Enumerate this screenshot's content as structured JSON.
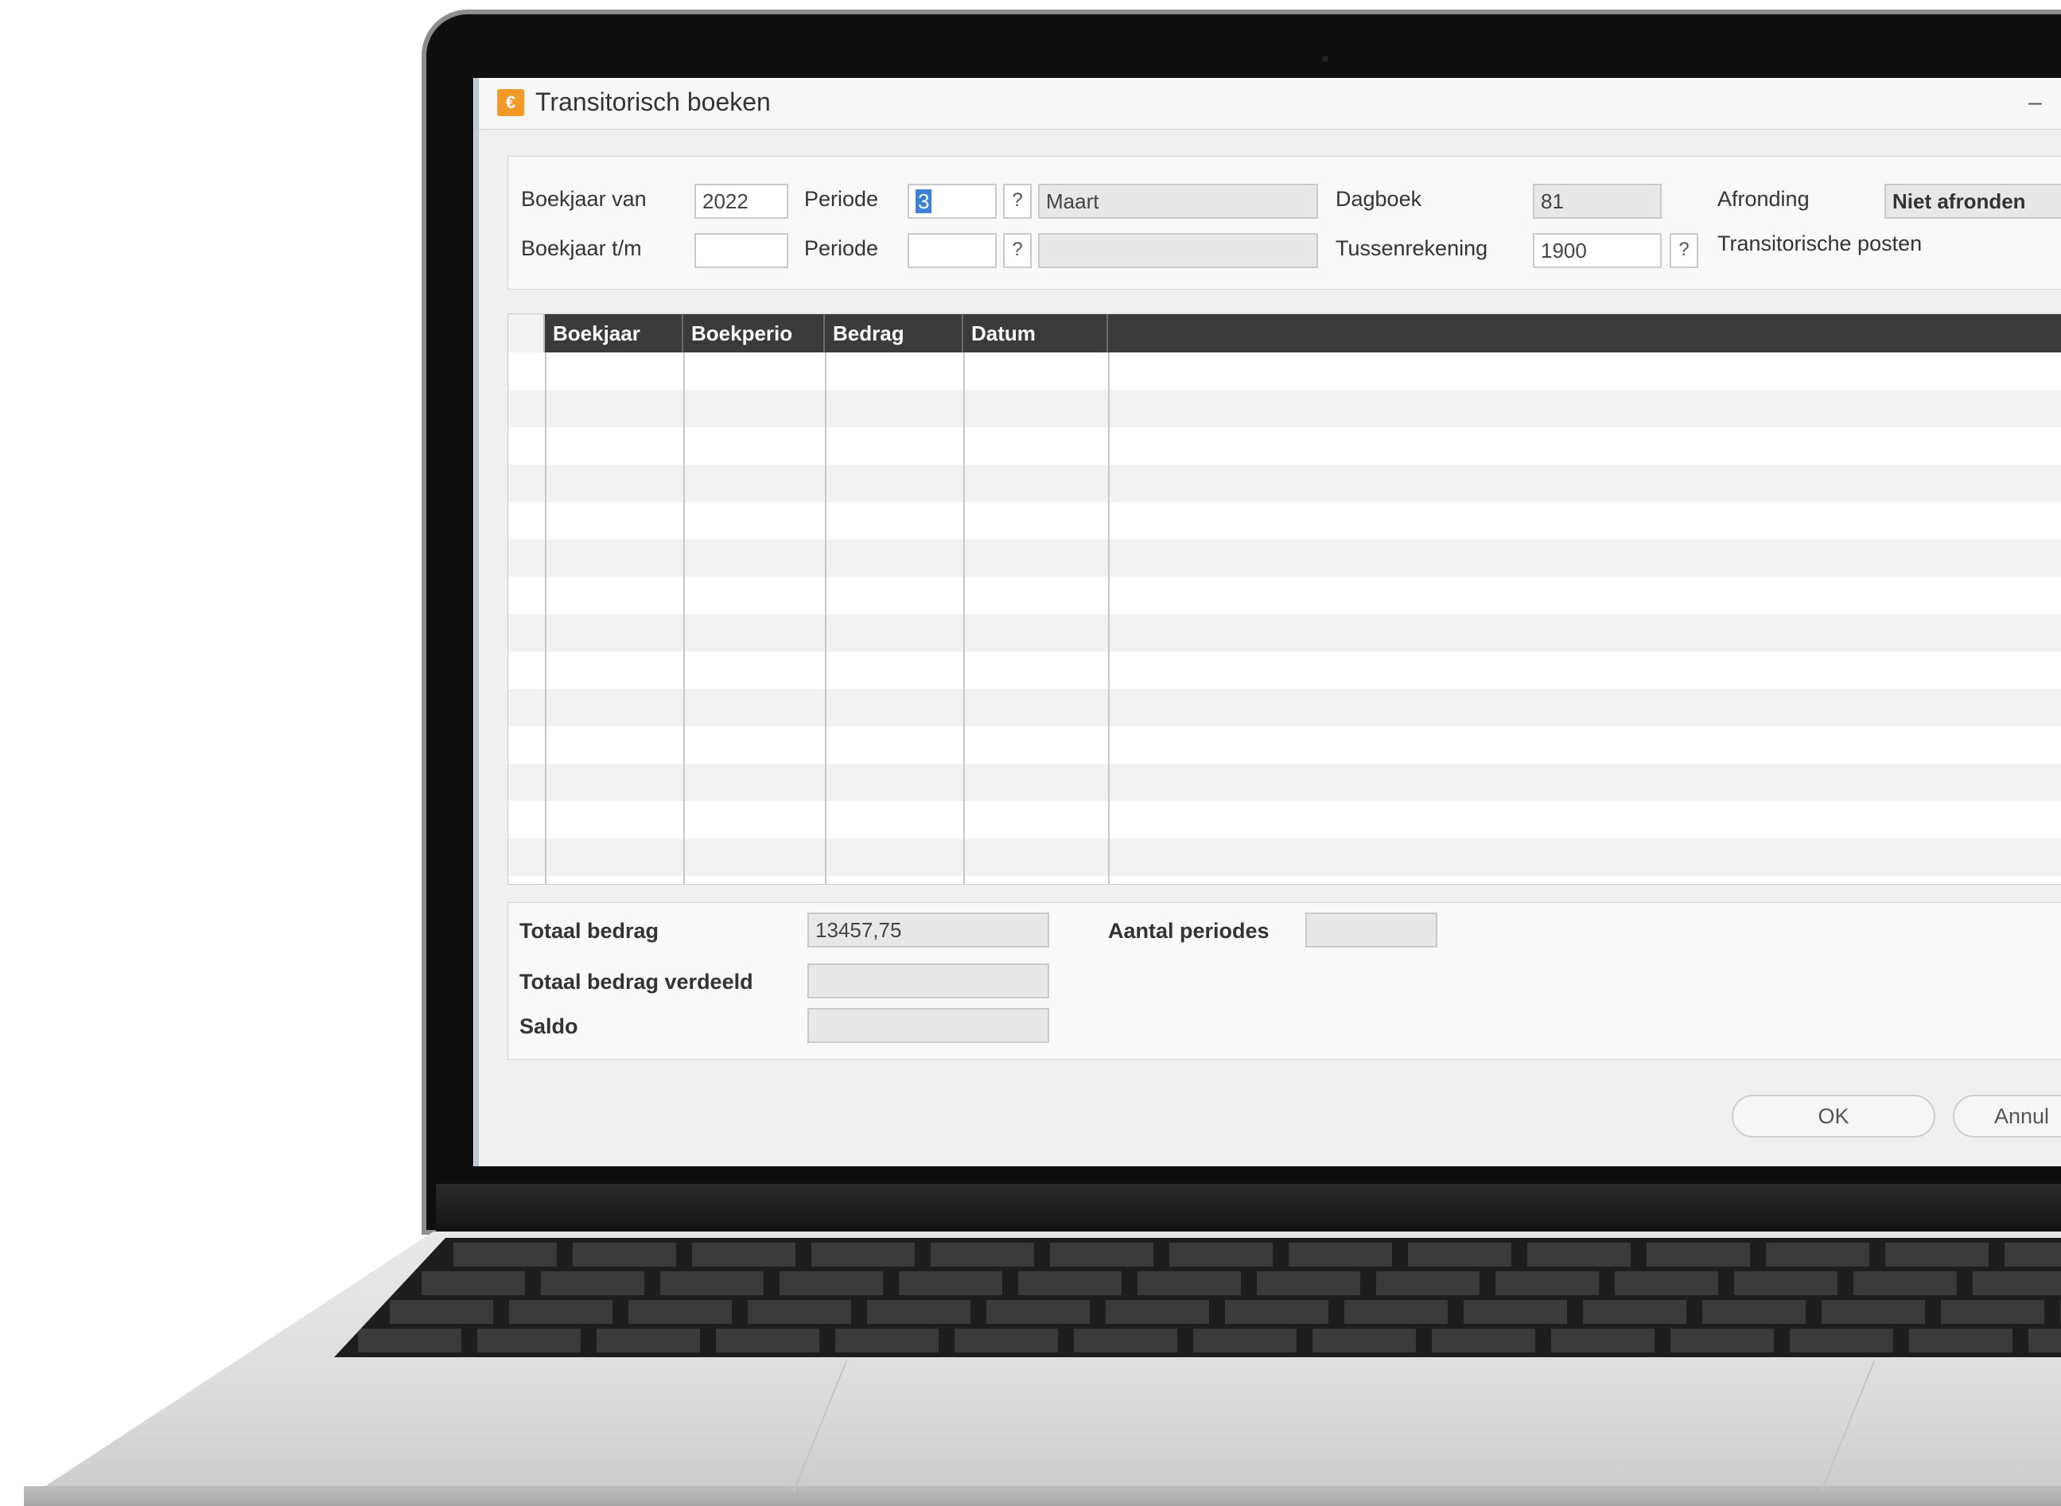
{
  "window": {
    "title": "Transitorisch boeken",
    "app_icon": "euro-icon",
    "minimize_symbol": "–"
  },
  "header": {
    "boekjaar_van_label": "Boekjaar van",
    "boekjaar_van_value": "2022",
    "periode_label": "Periode",
    "periode_van_value": "3",
    "periode_van_name": "Maart",
    "boekjaar_tm_label": "Boekjaar t/m",
    "boekjaar_tm_value": "",
    "periode_tm_value": "",
    "periode_tm_name": "",
    "lookup_symbol": "?",
    "dagboek_label": "Dagboek",
    "dagboek_value": "81",
    "tussenrekening_label": "Tussenrekening",
    "tussenrekening_value": "1900",
    "tussenrekening_name": "Transitorische posten",
    "afronding_label": "Afronding",
    "afronding_value": "Niet afronden"
  },
  "grid": {
    "columns": [
      "Boekjaar",
      "Boekperio",
      "Bedrag",
      "Datum",
      ""
    ],
    "rows": []
  },
  "totals": {
    "totaal_bedrag_label": "Totaal bedrag",
    "totaal_bedrag_value": "13457,75",
    "totaal_verdeeld_label": "Totaal bedrag verdeeld",
    "totaal_verdeeld_value": "",
    "saldo_label": "Saldo",
    "saldo_value": "",
    "aantal_periodes_label": "Aantal periodes",
    "aantal_periodes_value": ""
  },
  "buttons": {
    "ok_label": "OK",
    "annuleren_label": "Annul"
  },
  "colors": {
    "grid_header": "#3a3a3a",
    "selection": "#3b82d6",
    "app_icon": "#f19a2a"
  }
}
